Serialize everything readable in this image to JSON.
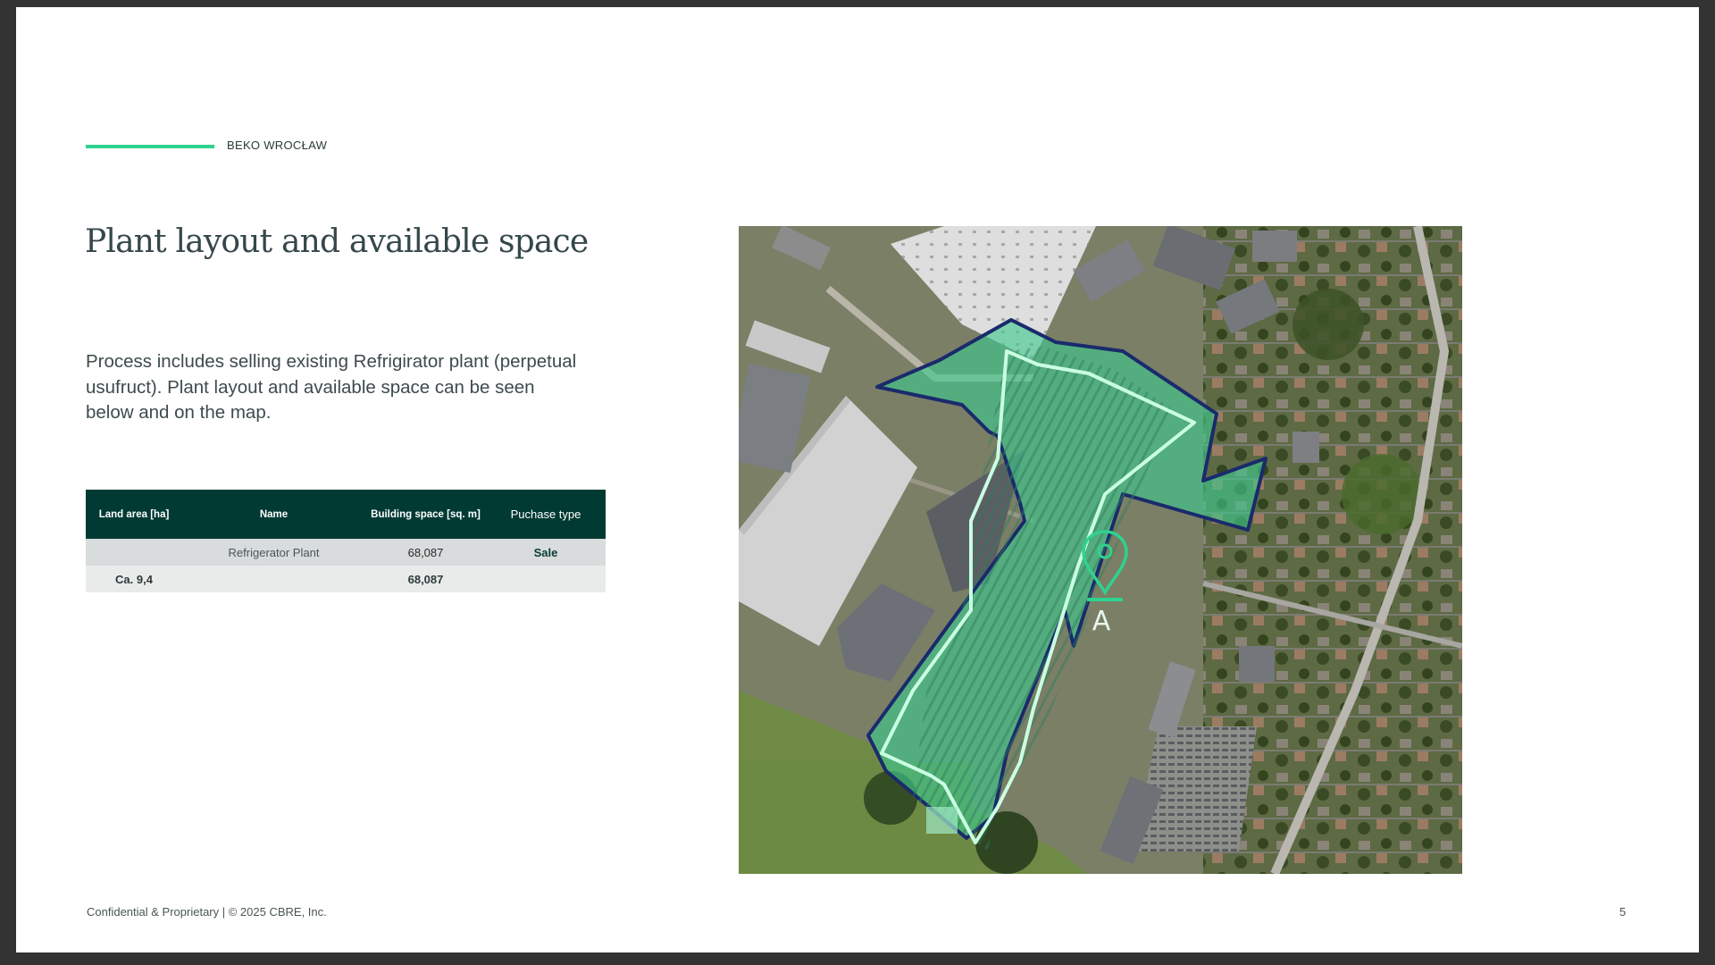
{
  "header": {
    "eyebrow": "BEKO WROCŁAW"
  },
  "title": "Plant layout and available space",
  "body": "Process includes selling existing Refrigirator plant (perpetual usufruct). Plant layout and available space can be seen below and on the map.",
  "table": {
    "headers": [
      "Land area [ha]",
      "Name",
      "Building space [sq. m]",
      "Puchase type"
    ],
    "rows": [
      [
        "",
        "Refrigerator Plant",
        "68,087",
        "Sale"
      ],
      [
        "Ca. 9,4",
        "",
        "68,087",
        ""
      ]
    ]
  },
  "map": {
    "marker_label": "A",
    "colors": {
      "site_fill": "#3ec98e",
      "building_outline": "#c9ffe3",
      "site_outline": "#1a2a6c",
      "marker": "#2fd28e"
    }
  },
  "footer": {
    "text": "Confidential & Proprietary | © 2025 CBRE, Inc.",
    "page": "5"
  }
}
